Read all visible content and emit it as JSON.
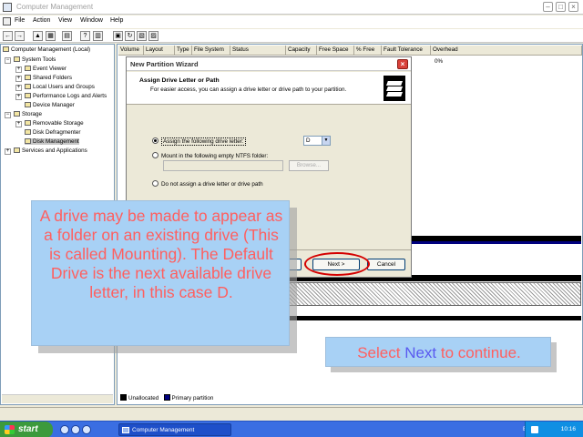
{
  "window": {
    "title": "Computer Management",
    "menu": [
      "File",
      "Action",
      "View",
      "Window",
      "Help"
    ]
  },
  "tree": {
    "root": "Computer Management (Local)",
    "nodes": [
      "System Tools",
      "Event Viewer",
      "Shared Folders",
      "Local Users and Groups",
      "Performance Logs and Alerts",
      "Device Manager",
      "Storage",
      "Removable Storage",
      "Disk Defragmenter",
      "Disk Management",
      "Services and Applications"
    ]
  },
  "columns": [
    "Volume",
    "Layout",
    "Type",
    "File System",
    "Status",
    "Capacity",
    "Free Space",
    "% Free",
    "Fault Tolerance",
    "Overhead"
  ],
  "overhead_value": "0%",
  "legend": {
    "unallocated": "Unallocated",
    "primary": "Primary partition",
    "unallocated_color": "#000000",
    "primary_color": "#00007f"
  },
  "wizard": {
    "title": "New Partition Wizard",
    "heading": "Assign Drive Letter or Path",
    "subheading": "For easier access, you can assign a drive letter or drive path to your partition.",
    "option_assign": "Assign the following drive letter:",
    "drive_letter": "D",
    "option_mount": "Mount in the following empty NTFS folder:",
    "browse_label": "Browse...",
    "option_none": "Do not assign a drive letter or drive path",
    "back_label": "< Back",
    "next_label": "Next >",
    "cancel_label": "Cancel"
  },
  "callouts": {
    "main": "A drive may be made to appear as a folder on an existing drive (This is called Mounting). The Default Drive is the next available drive letter, in this case D.",
    "continue_pre": "Select ",
    "continue_hl": "Next",
    "continue_post": " to continue.",
    "text_color": "#ff5f5f",
    "highlight_color": "#5a5af0",
    "bg_color": "#a8d1f5"
  },
  "taskbar": {
    "start_label": "start",
    "task_label": "Computer Management",
    "language": "EN",
    "clock": "10:16"
  }
}
